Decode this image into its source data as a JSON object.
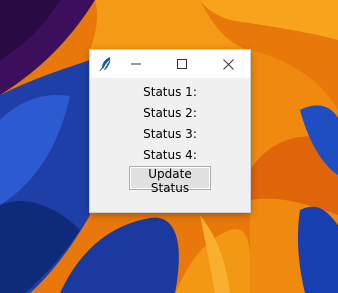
{
  "window": {
    "icon": "feather-icon",
    "controls": {
      "minimize_icon": "minimize-icon",
      "maximize_icon": "maximize-icon",
      "close_icon": "close-icon"
    }
  },
  "statuses": [
    {
      "label": "Status 1:"
    },
    {
      "label": "Status 2:"
    },
    {
      "label": "Status 3:"
    },
    {
      "label": "Status 4:"
    }
  ],
  "update_button": {
    "label": "Update Status"
  },
  "colors": {
    "window_bg": "#f0f0f0",
    "titlebar_bg": "#ffffff",
    "button_bg": "#e1e1e1",
    "wallpaper_orange": "#f28a0c",
    "wallpaper_blue": "#1648b8",
    "wallpaper_purple": "#4a1470"
  }
}
